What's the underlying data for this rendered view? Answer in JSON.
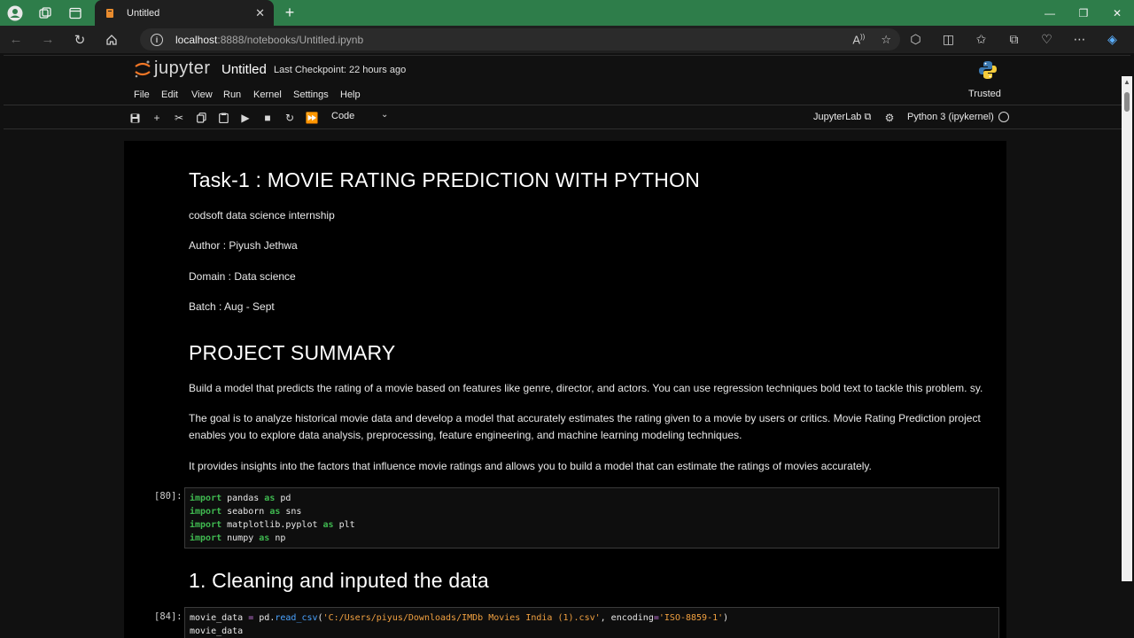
{
  "browser": {
    "tab_title": "Untitled",
    "url_host": "localhost",
    "url_path": ":8888/notebooks/Untitled.ipynb"
  },
  "jupyter": {
    "logo_text": "jupyter",
    "notebook_title": "Untitled",
    "checkpoint": "Last Checkpoint: 22 hours ago",
    "menu": [
      "File",
      "Edit",
      "View",
      "Run",
      "Kernel",
      "Settings",
      "Help"
    ],
    "trusted": "Trusted",
    "cell_type": "Code",
    "jupyterlab_link": "JupyterLab",
    "kernel_name": "Python 3 (ipykernel)"
  },
  "notebook": {
    "title": "Task-1 : MOVIE RATING PREDICTION WITH PYTHON",
    "subtitle": "codsoft data science internship",
    "author": "Author : Piyush Jethwa",
    "domain": "Domain : Data science",
    "batch": "Batch : Aug - Sept",
    "summary_heading": "PROJECT SUMMARY",
    "summary_p1": "Build a model that predicts the rating of a movie based on features like genre, director, and actors. You can use regression techniques bold text to tackle this problem. sy.",
    "summary_p2_line1": "The goal is to analyze historical movie data and develop a model that accurately estimates the rating given to a movie by users or critics. Movie Rating Prediction project",
    "summary_p2_line2": "enables you to explore data analysis, preprocessing, feature engineering, and machine learning modeling techniques.",
    "summary_p3": "It provides insights into the factors that influence movie ratings and allows you to build a model that can estimate the ratings of movies accurately.",
    "cell1_prompt": "[80]:",
    "cell1_lines": [
      {
        "kw": "import",
        "mod": " pandas ",
        "as": "as",
        "alias": " pd"
      },
      {
        "kw": "import",
        "mod": " seaborn ",
        "as": "as",
        "alias": " sns"
      },
      {
        "kw": "import",
        "mod": " matplotlib.pyplot ",
        "as": "as",
        "alias": " plt"
      },
      {
        "kw": "import",
        "mod": " numpy ",
        "as": "as",
        "alias": " np"
      }
    ],
    "section1_heading": "1. Cleaning and inputed the data",
    "cell2_prompt": "[84]:",
    "cell2_var": "movie_data ",
    "cell2_eq": "=",
    "cell2_pd": " pd.",
    "cell2_fn": "read_csv",
    "cell2_open": "(",
    "cell2_path": "'C:/Users/piyus/Downloads/IMDb Movies India (1).csv'",
    "cell2_comma": ", encoding",
    "cell2_eq2": "=",
    "cell2_enc": "'ISO-8859-1'",
    "cell2_close": ")",
    "cell2_line2": "movie_data"
  }
}
